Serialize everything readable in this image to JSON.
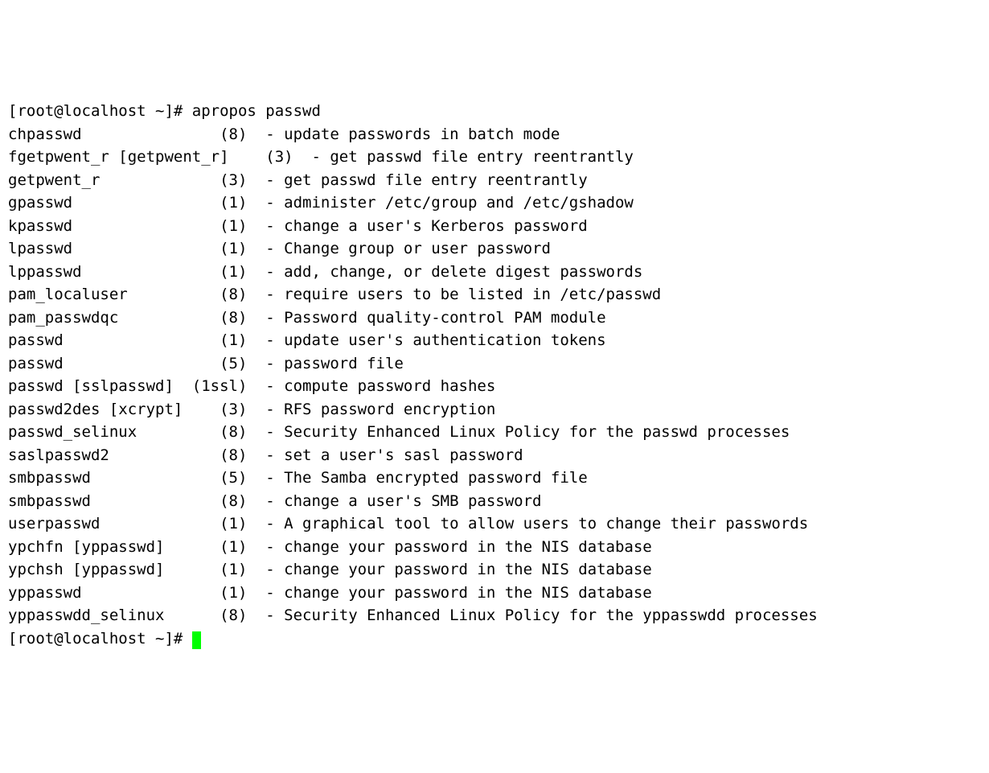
{
  "prompt1": "[root@localhost ~]# apropos passwd",
  "entries": [
    {
      "name": "chpasswd",
      "section": "(8)",
      "desc": "update passwords in batch mode"
    },
    {
      "name": "fgetpwent_r [getpwent_r]",
      "section": "(3)",
      "desc": "get passwd file entry reentrantly"
    },
    {
      "name": "getpwent_r",
      "section": "(3)",
      "desc": "get passwd file entry reentrantly"
    },
    {
      "name": "gpasswd",
      "section": "(1)",
      "desc": "administer /etc/group and /etc/gshadow"
    },
    {
      "name": "kpasswd",
      "section": "(1)",
      "desc": "change a user's Kerberos password"
    },
    {
      "name": "lpasswd",
      "section": "(1)",
      "desc": "Change group or user password"
    },
    {
      "name": "lppasswd",
      "section": "(1)",
      "desc": "add, change, or delete digest passwords"
    },
    {
      "name": "pam_localuser",
      "section": "(8)",
      "desc": "require users to be listed in /etc/passwd"
    },
    {
      "name": "pam_passwdqc",
      "section": "(8)",
      "desc": "Password quality-control PAM module"
    },
    {
      "name": "passwd",
      "section": "(1)",
      "desc": "update user's authentication tokens"
    },
    {
      "name": "passwd",
      "section": "(5)",
      "desc": "password file"
    },
    {
      "name": "passwd [sslpasswd]",
      "section": "(1ssl)",
      "desc": "compute password hashes"
    },
    {
      "name": "passwd2des [xcrypt]",
      "section": "(3)",
      "desc": "RFS password encryption"
    },
    {
      "name": "passwd_selinux",
      "section": "(8)",
      "desc": "Security Enhanced Linux Policy for the passwd processes"
    },
    {
      "name": "saslpasswd2",
      "section": "(8)",
      "desc": "set a user's sasl password"
    },
    {
      "name": "smbpasswd",
      "section": "(5)",
      "desc": "The Samba encrypted password file"
    },
    {
      "name": "smbpasswd",
      "section": "(8)",
      "desc": "change a user's SMB password"
    },
    {
      "name": "userpasswd",
      "section": "(1)",
      "desc": "A graphical tool to allow users to change their passwords"
    },
    {
      "name": "ypchfn [yppasswd]",
      "section": "(1)",
      "desc": "change your password in the NIS database"
    },
    {
      "name": "ypchsh [yppasswd]",
      "section": "(1)",
      "desc": "change your password in the NIS database"
    },
    {
      "name": "yppasswd",
      "section": "(1)",
      "desc": "change your password in the NIS database"
    },
    {
      "name": "yppasswdd_selinux",
      "section": "(8)",
      "desc": "Security Enhanced Linux Policy for the yppasswdd processes"
    }
  ],
  "prompt2": "[root@localhost ~]# ",
  "nameColWidth": 20,
  "sectionColWidth": 6
}
